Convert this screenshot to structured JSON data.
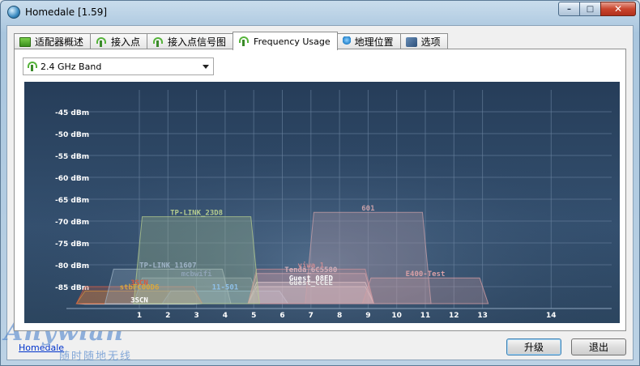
{
  "window": {
    "title": "Homedale [1.59]",
    "caption": {
      "minimize": "–",
      "maximize": "□",
      "close": "✕"
    }
  },
  "tabs": [
    {
      "label": "适配器概述",
      "icon": "adapter-icon"
    },
    {
      "label": "接入点",
      "icon": "signal-icon"
    },
    {
      "label": "接入点信号图",
      "icon": "signal-icon"
    },
    {
      "label": "Frequency Usage",
      "icon": "signal-icon",
      "active": true
    },
    {
      "label": "地理位置",
      "icon": "location-pin-icon"
    },
    {
      "label": "选项",
      "icon": "wrench-icon"
    }
  ],
  "band_select": {
    "value": "2.4 GHz Band"
  },
  "chart_data": {
    "type": "area",
    "title": "",
    "xlabel": "",
    "ylabel": "",
    "x_ticks": [
      1,
      2,
      3,
      4,
      5,
      6,
      7,
      8,
      9,
      10,
      11,
      12,
      13,
      14
    ],
    "y_ticks": [
      "-45 dBm",
      "-50 dBm",
      "-55 dBm",
      "-60 dBm",
      "-65 dBm",
      "-70 dBm",
      "-75 dBm",
      "-80 dBm",
      "-85 dBm"
    ],
    "ylim": [
      -90,
      -40
    ],
    "grid": true,
    "series": [
      {
        "name": "TP-LINK_23D8",
        "channel": 3,
        "signal": -69,
        "color": "#b5cc8e"
      },
      {
        "name": "601",
        "channel": 9,
        "signal": -68,
        "color": "#c9a0a8"
      },
      {
        "name": "TP-LINK_11607",
        "channel": 2,
        "signal": -81,
        "color": "#9fb3c6"
      },
      {
        "name": "mcbwifi",
        "channel": 3,
        "signal": -83,
        "color": "#8fa3b5"
      },
      {
        "name": "3SCN",
        "channel": 1,
        "signal": -85,
        "color": "#d85a3e"
      },
      {
        "name": "stbFC00D6",
        "channel": 1,
        "signal": -86,
        "color": "#d9a83c"
      },
      {
        "name": "Tenda_6C5580",
        "channel": 7,
        "signal": -82,
        "color": "#d3b0ba"
      },
      {
        "name": "yiwa_1",
        "channel": 7,
        "signal": -81,
        "color": "#c98c94"
      },
      {
        "name": "Guest_08ED",
        "channel": 7,
        "signal": -84,
        "color": "#ffffff"
      },
      {
        "name": "Guest_CCEE",
        "channel": 7,
        "signal": -85,
        "color": "#e8e8e8"
      },
      {
        "name": "E400-Test",
        "channel": 11,
        "signal": -83,
        "color": "#d9a0a6"
      },
      {
        "name": "11-501",
        "channel": 4,
        "signal": -86,
        "color": "#8fc0e8"
      },
      {
        "name": "3SCN",
        "channel": 1,
        "signal": -89,
        "color": "#ffffff"
      }
    ]
  },
  "buttons": {
    "upgrade": "升级",
    "exit": "退出"
  },
  "footer": {
    "homepage": "Homedale"
  },
  "watermark": {
    "main": "Anywlan",
    "sub": "随时随地无线"
  }
}
